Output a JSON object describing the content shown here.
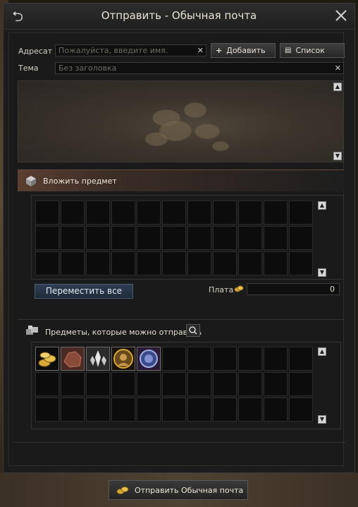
{
  "window": {
    "title": "Отправить - Обычная почта"
  },
  "form": {
    "recipient_label": "Адресат",
    "recipient_placeholder": "Пожалуйста, введите имя.",
    "add_button": "Добавить",
    "list_button": "Список",
    "subject_label": "Тема",
    "subject_placeholder": "Без заголовка"
  },
  "attach": {
    "header": "Вложить предмет",
    "move_all_button": "Переместить все",
    "fee_label": "Плата",
    "fee_value": "0"
  },
  "inventory": {
    "header": "Предметы, которые можно отправить",
    "items": [
      "gold-coins-icon",
      "ore-chunk-icon",
      "crystal-icon",
      "portrait-medallion-icon",
      "blue-seal-icon"
    ]
  },
  "footer": {
    "send_button": "Отправить Обычная почта"
  },
  "colors": {
    "accent": "#d6a93a",
    "section": "#5a3e30"
  }
}
